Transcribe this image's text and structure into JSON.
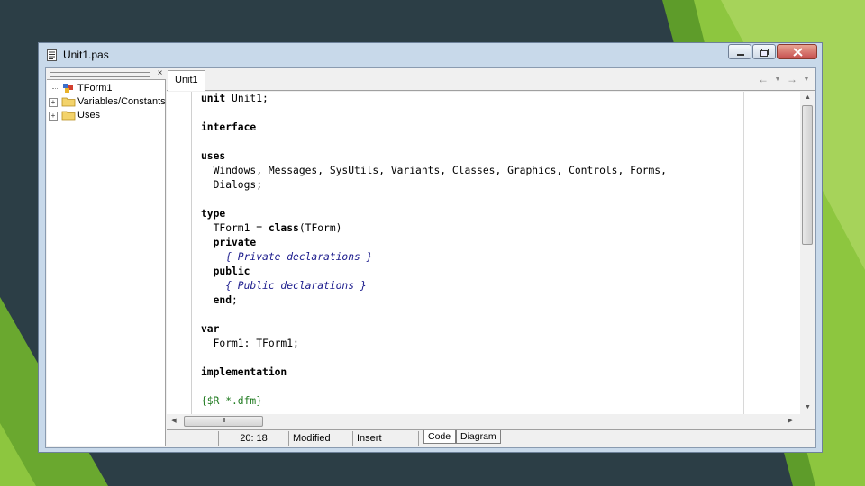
{
  "window": {
    "title": "Unit1.pas",
    "minimize_icon": "minimize-icon",
    "maximize_icon": "maximize-icon",
    "close_icon": "close-icon"
  },
  "explorer": {
    "close_glyph": "×",
    "items": [
      {
        "label": "TForm1",
        "icon": "class-icon",
        "expandable": false
      },
      {
        "label": "Variables/Constants",
        "icon": "folder-icon",
        "expandable": true
      },
      {
        "label": "Uses",
        "icon": "folder-icon",
        "expandable": true
      }
    ]
  },
  "tabs": {
    "active": "Unit1"
  },
  "nav": {
    "back_icon": "arrow-left-icon",
    "forward_icon": "arrow-right-icon"
  },
  "code": {
    "line_1": "unit Unit1;",
    "line_3": "interface",
    "line_5": "uses",
    "line_6": "  Windows, Messages, SysUtils, Variants, Classes, Graphics, Controls, Forms,",
    "line_7": "  Dialogs;",
    "line_9": "type",
    "line_10": "  TForm1 = class(TForm)",
    "line_11": "  private",
    "line_12": "    { Private declarations }",
    "line_13": "  public",
    "line_14": "    { Public declarations }",
    "line_15": "  end;",
    "line_17": "var",
    "line_18": "  Form1: TForm1;",
    "line_20": "implementation",
    "line_22": "{$R *.dfm}"
  },
  "hscroll": {
    "thumb_grip": "III"
  },
  "status": {
    "position": "20: 18",
    "modified": "Modified",
    "mode": "Insert",
    "tab_code": "Code",
    "tab_diagram": "Diagram"
  },
  "colors": {
    "background": "#2c3e46",
    "accent_green": "#8dc63f",
    "comment": "#1a1a8c",
    "directive": "#1f7a1f"
  }
}
